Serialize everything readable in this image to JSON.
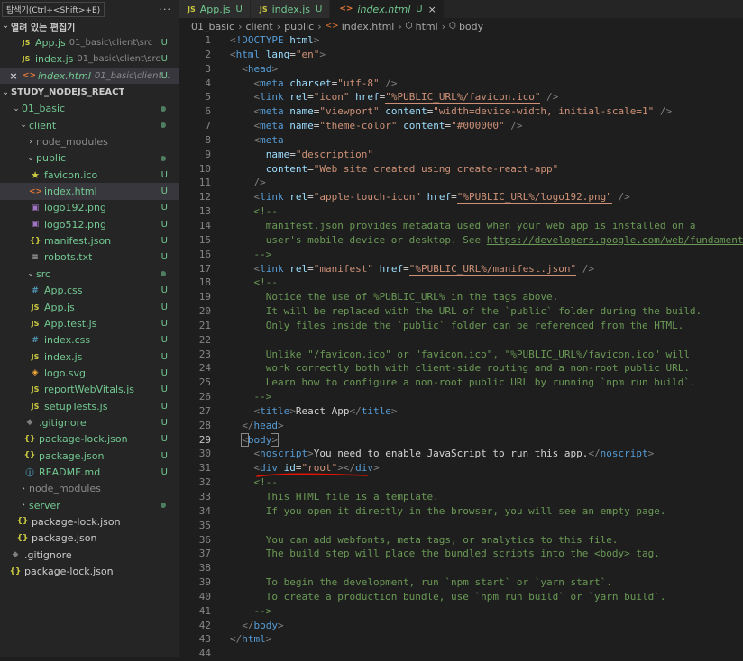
{
  "explorer": {
    "tooltip": "탐색기(Ctrl+<Shift>+E)",
    "more": "···",
    "open_editors_label": "열려 있는 편집기",
    "open_editors": [
      {
        "icon": "JS",
        "name": "App.js",
        "path": "01_basic\\client\\src",
        "badge": "U"
      },
      {
        "icon": "JS",
        "name": "index.js",
        "path": "01_basic\\client\\src",
        "badge": "U"
      },
      {
        "icon": "<>",
        "name": "index.html",
        "path": "01_basic\\client...",
        "badge": "U"
      }
    ],
    "project_label": "STUDY_NODEJS_REACT",
    "tree": [
      {
        "name": "01_basic"
      },
      {
        "name": "client"
      },
      {
        "name": "node_modules"
      },
      {
        "name": "public"
      },
      {
        "name": "favicon.ico",
        "badge": "U"
      },
      {
        "name": "index.html",
        "badge": "U"
      },
      {
        "name": "logo192.png",
        "badge": "U"
      },
      {
        "name": "logo512.png",
        "badge": "U"
      },
      {
        "name": "manifest.json",
        "badge": "U"
      },
      {
        "name": "robots.txt",
        "badge": "U"
      },
      {
        "name": "src"
      },
      {
        "name": "App.css",
        "badge": "U"
      },
      {
        "name": "App.js",
        "badge": "U"
      },
      {
        "name": "App.test.js",
        "badge": "U"
      },
      {
        "name": "index.css",
        "badge": "U"
      },
      {
        "name": "index.js",
        "badge": "U"
      },
      {
        "name": "logo.svg",
        "badge": "U"
      },
      {
        "name": "reportWebVitals.js",
        "badge": "U"
      },
      {
        "name": "setupTests.js",
        "badge": "U"
      },
      {
        "name": ".gitignore",
        "badge": "U"
      },
      {
        "name": "package-lock.json",
        "badge": "U"
      },
      {
        "name": "package.json",
        "badge": "U"
      },
      {
        "name": "README.md",
        "badge": "U"
      },
      {
        "name": "node_modules"
      },
      {
        "name": "server"
      },
      {
        "name": "package-lock.json"
      },
      {
        "name": "package.json"
      },
      {
        "name": ".gitignore"
      },
      {
        "name": "package-lock.json"
      }
    ]
  },
  "tabs": [
    {
      "icon": "JS",
      "label": "App.js",
      "badge": "U"
    },
    {
      "icon": "JS",
      "label": "index.js",
      "badge": "U"
    },
    {
      "icon": "<>",
      "label": "index.html",
      "badge": "U",
      "close": "×"
    }
  ],
  "breadcrumb": {
    "items": [
      "01_basic",
      "client",
      "public",
      "index.html",
      "html",
      "body"
    ],
    "sep": "›"
  },
  "code": {
    "line_numbers": [
      "1",
      "2",
      "3",
      "4",
      "5",
      "6",
      "7",
      "8",
      "9",
      "10",
      "11",
      "12",
      "13",
      "14",
      "15",
      "16",
      "17",
      "18",
      "19",
      "20",
      "21",
      "22",
      "23",
      "24",
      "25",
      "26",
      "27",
      "28",
      "29",
      "30",
      "31",
      "32",
      "33",
      "34",
      "35",
      "36",
      "37",
      "38",
      "39",
      "40",
      "41",
      "42",
      "43",
      "44"
    ],
    "current_line": 29,
    "lines": [
      "<!DOCTYPE html>",
      "<html lang=\"en\">",
      "  <head>",
      "    <meta charset=\"utf-8\" />",
      "    <link rel=\"icon\" href=\"%PUBLIC_URL%/favicon.ico\" />",
      "    <meta name=\"viewport\" content=\"width=device-width, initial-scale=1\" />",
      "    <meta name=\"theme-color\" content=\"#000000\" />",
      "    <meta",
      "      name=\"description\"",
      "      content=\"Web site created using create-react-app\"",
      "    />",
      "    <link rel=\"apple-touch-icon\" href=\"%PUBLIC_URL%/logo192.png\" />",
      "    <!--",
      "      manifest.json provides metadata used when your web app is installed on a",
      "      user's mobile device or desktop. See https://developers.google.com/web/fundamentals",
      "    -->",
      "    <link rel=\"manifest\" href=\"%PUBLIC_URL%/manifest.json\" />",
      "    <!--",
      "      Notice the use of %PUBLIC_URL% in the tags above.",
      "      It will be replaced with the URL of the `public` folder during the build.",
      "      Only files inside the `public` folder can be referenced from the HTML.",
      "",
      "      Unlike \"/favicon.ico\" or \"favicon.ico\", \"%PUBLIC_URL%/favicon.ico\" will",
      "      work correctly both with client-side routing and a non-root public URL.",
      "      Learn how to configure a non-root public URL by running `npm run build`.",
      "    -->",
      "    <title>React App</title>",
      "  </head>",
      "  <body>",
      "    <noscript>You need to enable JavaScript to run this app.</noscript>",
      "    <div id=\"root\"></div>",
      "    <!--",
      "      This HTML file is a template.",
      "      If you open it directly in the browser, you will see an empty page.",
      "",
      "      You can add webfonts, meta tags, or analytics to this file.",
      "      The build step will place the bundled scripts into the <body> tag.",
      "",
      "      To begin the development, run `npm start` or `yarn start`.",
      "      To create a production bundle, use `npm run build` or `yarn build`.",
      "    -->",
      "  </body>",
      "</html>",
      ""
    ]
  },
  "colors": {
    "tag": "#569cd6",
    "attribute": "#9cdcfe",
    "string": "#ce9178",
    "comment": "#6a9955",
    "untracked": "#73c991",
    "annotation": "#e51400"
  }
}
